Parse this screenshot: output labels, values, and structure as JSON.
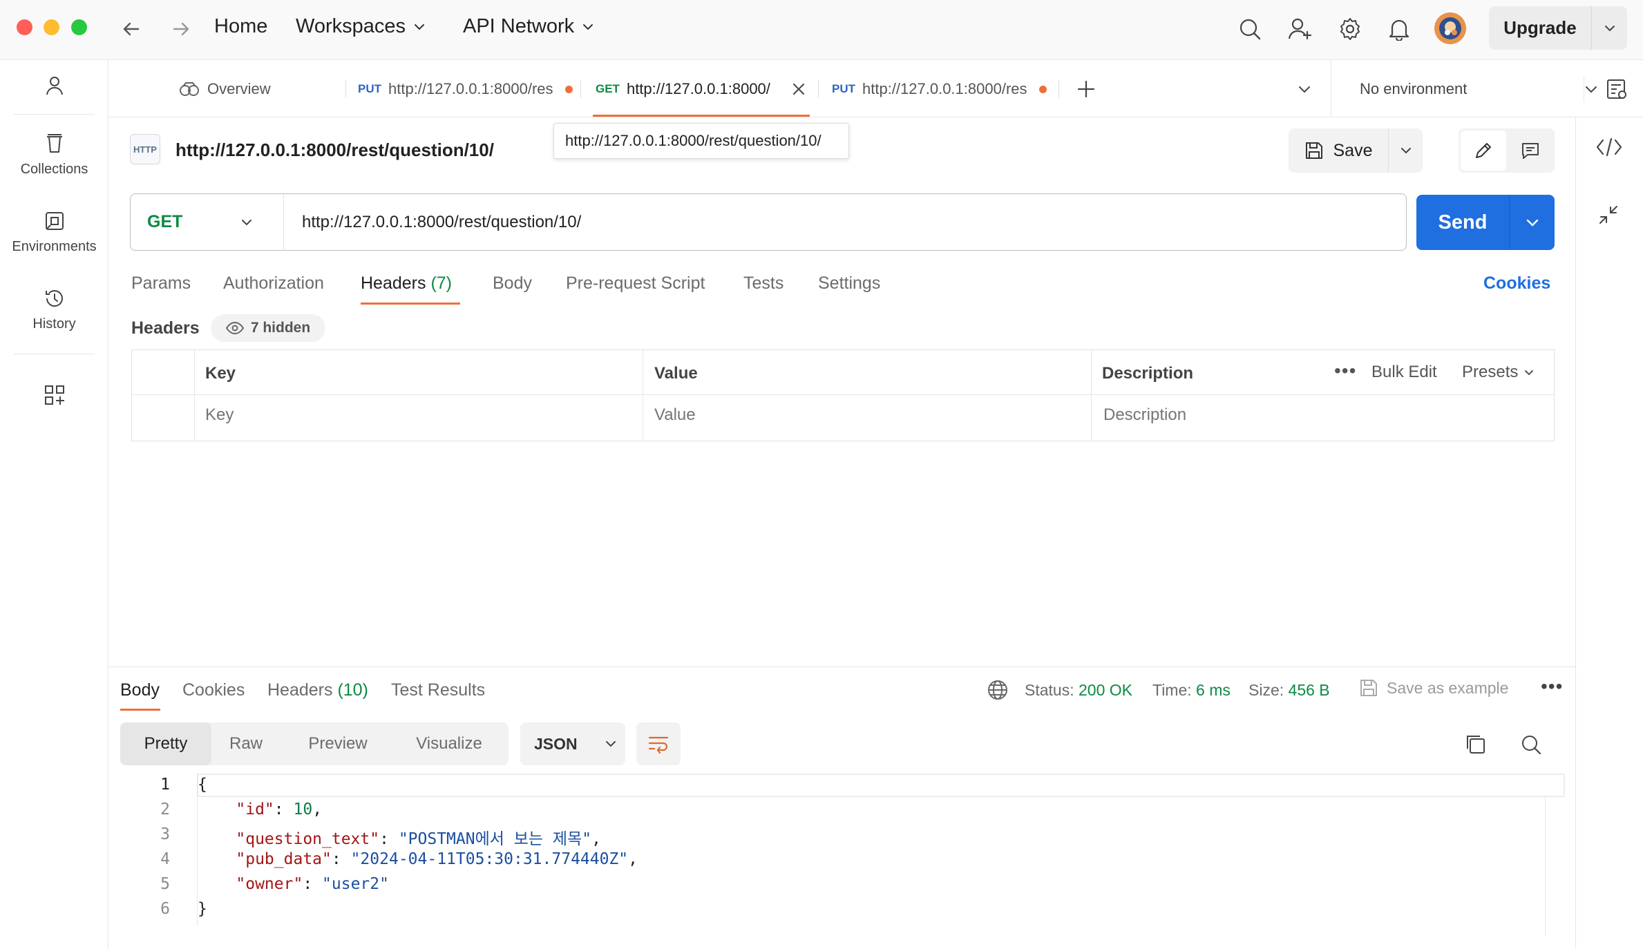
{
  "topbar": {
    "home": "Home",
    "workspaces": "Workspaces",
    "api_network": "API Network",
    "upgrade": "Upgrade",
    "colors": {
      "close": "#ff5f57",
      "minimize": "#febc2e",
      "zoom": "#28c840"
    }
  },
  "sidebar": {
    "items": [
      {
        "label": "",
        "icon": "user-icon"
      },
      {
        "label": "Collections",
        "icon": "trash-can-icon"
      },
      {
        "label": "Environments",
        "icon": "environment-icon"
      },
      {
        "label": "History",
        "icon": "history-icon"
      },
      {
        "label": "",
        "icon": "apps-icon"
      }
    ]
  },
  "tabs": {
    "overview": "Overview",
    "items": [
      {
        "method": "PUT",
        "url": "http://127.0.0.1:8000/res",
        "unsaved": true
      },
      {
        "method": "GET",
        "url": "http://127.0.0.1:8000/",
        "active": true
      },
      {
        "method": "PUT",
        "url": "http://127.0.0.1:8000/res",
        "unsaved": true
      }
    ],
    "environment": "No environment",
    "tooltip": "http://127.0.0.1:8000/rest/question/10/"
  },
  "request": {
    "title": "http://127.0.0.1:8000/rest/question/10/",
    "badge": "HTTP",
    "save": "Save",
    "method": "GET",
    "url": "http://127.0.0.1:8000/rest/question/10/",
    "send": "Send",
    "tabs": [
      "Params",
      "Authorization",
      "Headers",
      "Body",
      "Pre-request Script",
      "Tests",
      "Settings"
    ],
    "headers_count": "(7)",
    "cookies": "Cookies",
    "headers_label": "Headers",
    "hidden_label": "7 hidden",
    "table": {
      "columns": [
        "Key",
        "Value",
        "Description"
      ],
      "placeholders": [
        "Key",
        "Value",
        "Description"
      ],
      "bulk_edit": "Bulk Edit",
      "presets": "Presets"
    }
  },
  "response": {
    "tabs": [
      "Body",
      "Cookies",
      "Headers",
      "Test Results"
    ],
    "headers_count": "(10)",
    "status_label": "Status:",
    "status_value": "200 OK",
    "time_label": "Time:",
    "time_value": "6 ms",
    "size_label": "Size:",
    "size_value": "456 B",
    "save_example": "Save as example",
    "views": [
      "Pretty",
      "Raw",
      "Preview",
      "Visualize"
    ],
    "format": "JSON",
    "code": {
      "line_numbers": [
        "1",
        "2",
        "3",
        "4",
        "5",
        "6"
      ],
      "open": "{",
      "close": "}",
      "fields": [
        {
          "key": "\"id\"",
          "value": "10",
          "type": "number"
        },
        {
          "key": "\"question_text\"",
          "value": "\"POSTMAN에서 보는 제목\"",
          "type": "string"
        },
        {
          "key": "\"pub_data\"",
          "value": "\"2024-04-11T05:30:31.774440Z\"",
          "type": "string"
        },
        {
          "key": "\"owner\"",
          "value": "\"user2\"",
          "type": "string"
        }
      ]
    }
  },
  "colors": {
    "accent": "#1f6fe0",
    "get_method": "#0c8a43",
    "put_method": "#2f63c7",
    "active_underline": "#ef6f3a",
    "status_ok": "#0c8a43"
  }
}
